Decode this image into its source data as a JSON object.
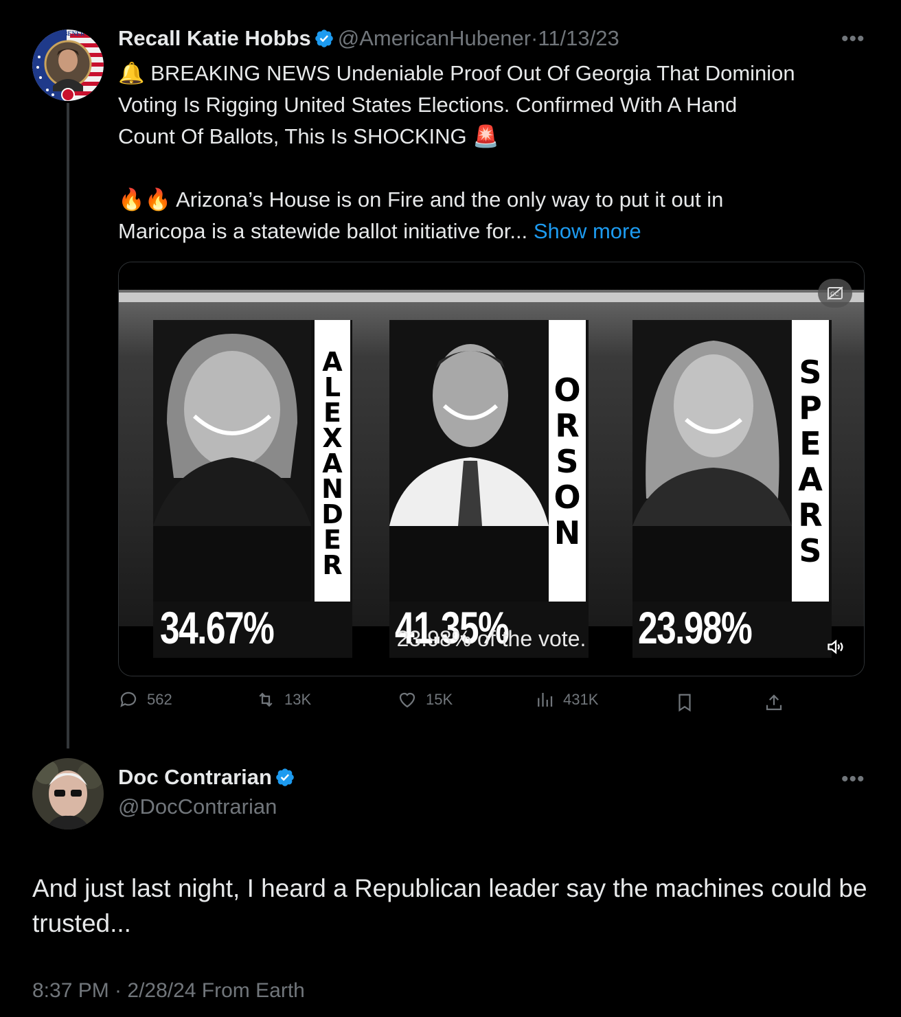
{
  "thread_tweet": {
    "author_name": "Recall Katie Hobbs",
    "author_handle": "@AmericanHubener",
    "date": "11/13/23",
    "avatar_badge_text": "HUBENER",
    "text_lines": [
      "🔔 BREAKING NEWS Undeniable Proof Out Of Georgia That Dominion",
      "Voting Is Rigging United States Elections. Confirmed With A Hand",
      "Count Of Ballots, This Is SHOCKING 🚨",
      "🔥🔥 Arizona’s House is on Fire and the only way to put it out in"
    ],
    "last_line": "Maricopa is a statewide ballot initiative for...",
    "show_more": "Show more",
    "video": {
      "candidates": [
        {
          "name": "ALEXANDER",
          "percent": "34.67%"
        },
        {
          "name": "ORSON",
          "percent": "41.35%"
        },
        {
          "name": "SPEARS",
          "percent": "23.98%"
        }
      ],
      "caption": "23.98% of the vote."
    },
    "actions": {
      "replies": "562",
      "reposts": "13K",
      "likes": "15K",
      "views": "431K"
    }
  },
  "reply_tweet": {
    "author_name": "Doc Contrarian",
    "author_handle": "@DocContrarian",
    "text": "And just last night, I heard a Republican leader say the machines could be trusted...",
    "timestamp": "8:37 PM · 2/28/24 From Earth"
  },
  "colors": {
    "background": "#000000",
    "text": "#e7e9ea",
    "muted": "#71767b",
    "link": "#1d9bf0",
    "verified": "#1d9bf0"
  },
  "icons": [
    "verified-badge-icon",
    "more-icon",
    "cc-icon",
    "volume-icon",
    "reply-icon",
    "repost-icon",
    "like-icon",
    "views-icon",
    "bookmark-icon",
    "share-icon"
  ]
}
